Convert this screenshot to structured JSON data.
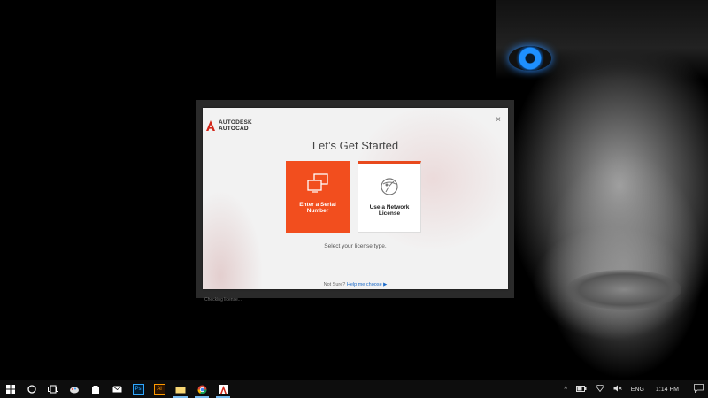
{
  "dialog": {
    "logo_brand": "AUTODESK",
    "logo_product": "AUTOCAD",
    "close_glyph": "×",
    "title": "Let’s Get Started",
    "options": [
      {
        "label": "Enter a Serial Number",
        "icon": "screens-icon"
      },
      {
        "label": "Use a Network License",
        "icon": "globe-icon"
      }
    ],
    "instruction": "Select your license type.",
    "footer_prefix": "Not Sure?",
    "footer_link": "Help me choose",
    "footer_arrow": "▶",
    "status_text": "Checking license..."
  },
  "taskbar": {
    "apps": [
      {
        "name": "start",
        "icon": "windows-icon"
      },
      {
        "name": "search",
        "icon": "circle-icon"
      },
      {
        "name": "task-view",
        "icon": "task-view-icon"
      },
      {
        "name": "paint",
        "icon": "paint-icon"
      },
      {
        "name": "store",
        "icon": "store-icon"
      },
      {
        "name": "mail",
        "icon": "mail-icon"
      },
      {
        "name": "photoshop",
        "icon": "photoshop-icon",
        "text": "Ps"
      },
      {
        "name": "illustrator",
        "icon": "illustrator-icon",
        "text": "Ai"
      },
      {
        "name": "file-explorer",
        "icon": "folder-icon"
      },
      {
        "name": "chrome",
        "icon": "chrome-icon"
      },
      {
        "name": "autocad",
        "icon": "autocad-icon"
      }
    ],
    "tray": {
      "chevron": "^",
      "language": "ENG",
      "time": "1:14 PM"
    }
  },
  "colors": {
    "accent": "#f24e1e",
    "link": "#1b6ac9",
    "taskbar": "#0d0d0d"
  }
}
